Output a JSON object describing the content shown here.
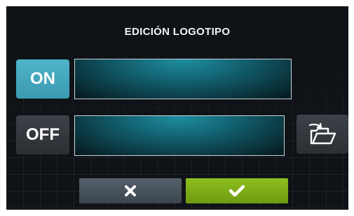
{
  "dialog": {
    "title": "EDICIÓN LOGOTIPO"
  },
  "logo_on": {
    "button_label": "ON",
    "field_value": ""
  },
  "logo_off": {
    "button_label": "OFF",
    "field_value": "",
    "folder_icon": "open-folder-icon"
  },
  "actions": {
    "cancel_icon": "close-icon",
    "confirm_icon": "check-icon"
  },
  "colors": {
    "on_button": "#3a9bb1",
    "confirm_button": "#7cac14",
    "cancel_button": "#4a555e",
    "field_fill": "#12606f"
  }
}
